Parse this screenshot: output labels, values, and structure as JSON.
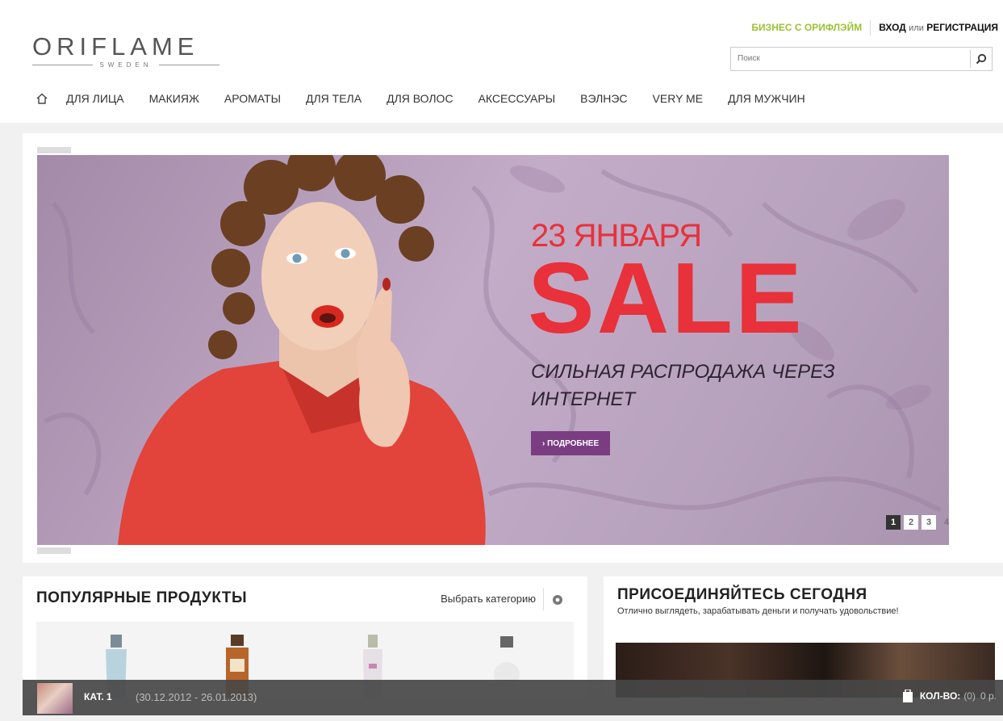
{
  "header": {
    "logo": {
      "word": "ORIFLAME",
      "sub": "SWEDEN"
    },
    "business_link": "БИЗНЕС С ОРИФЛЭЙМ",
    "login": "ВХОД",
    "or": "или",
    "register": "РЕГИСТРАЦИЯ",
    "search": {
      "placeholder": "Поиск"
    },
    "nav": [
      "ДЛЯ ЛИЦА",
      "МАКИЯЖ",
      "АРОМАТЫ",
      "ДЛЯ ТЕЛА",
      "ДЛЯ ВОЛОС",
      "АКСЕССУАРЫ",
      "ВЭЛНЭС",
      "VERY ME",
      "ДЛЯ МУЖЧИН"
    ]
  },
  "banner": {
    "date": "23 ЯНВАРЯ",
    "headline": "SALE",
    "tagline": "СИЛЬНАЯ РАСПРОДАЖА ЧЕРЕЗ ИНТЕРНЕТ",
    "more_button": "› ПОДРОБНЕЕ",
    "pages": [
      "1",
      "2",
      "3",
      "4"
    ],
    "active_page": 1
  },
  "popular": {
    "title": "ПОПУЛЯРНЫЕ ПРОДУКТЫ",
    "choose_category": "Выбрать категорию"
  },
  "join": {
    "title": "ПРИСОЕДИНЯЙТЕСЬ СЕГОДНЯ",
    "subtitle": "Отлично выглядеть, зарабатывать деньги и получать удовольствие!"
  },
  "footer": {
    "catalog": "КАТ. 1",
    "dates": "(30.12.2012 - 26.01.2013)",
    "qty_label": "КОЛ-ВО:",
    "qty_value": "(0)",
    "sum": "0 р."
  },
  "colors": {
    "accent_red": "#e8313a",
    "business_green": "#9bc233",
    "button_purple": "#7a3d82",
    "banner_bg": "#b7a2bd"
  }
}
